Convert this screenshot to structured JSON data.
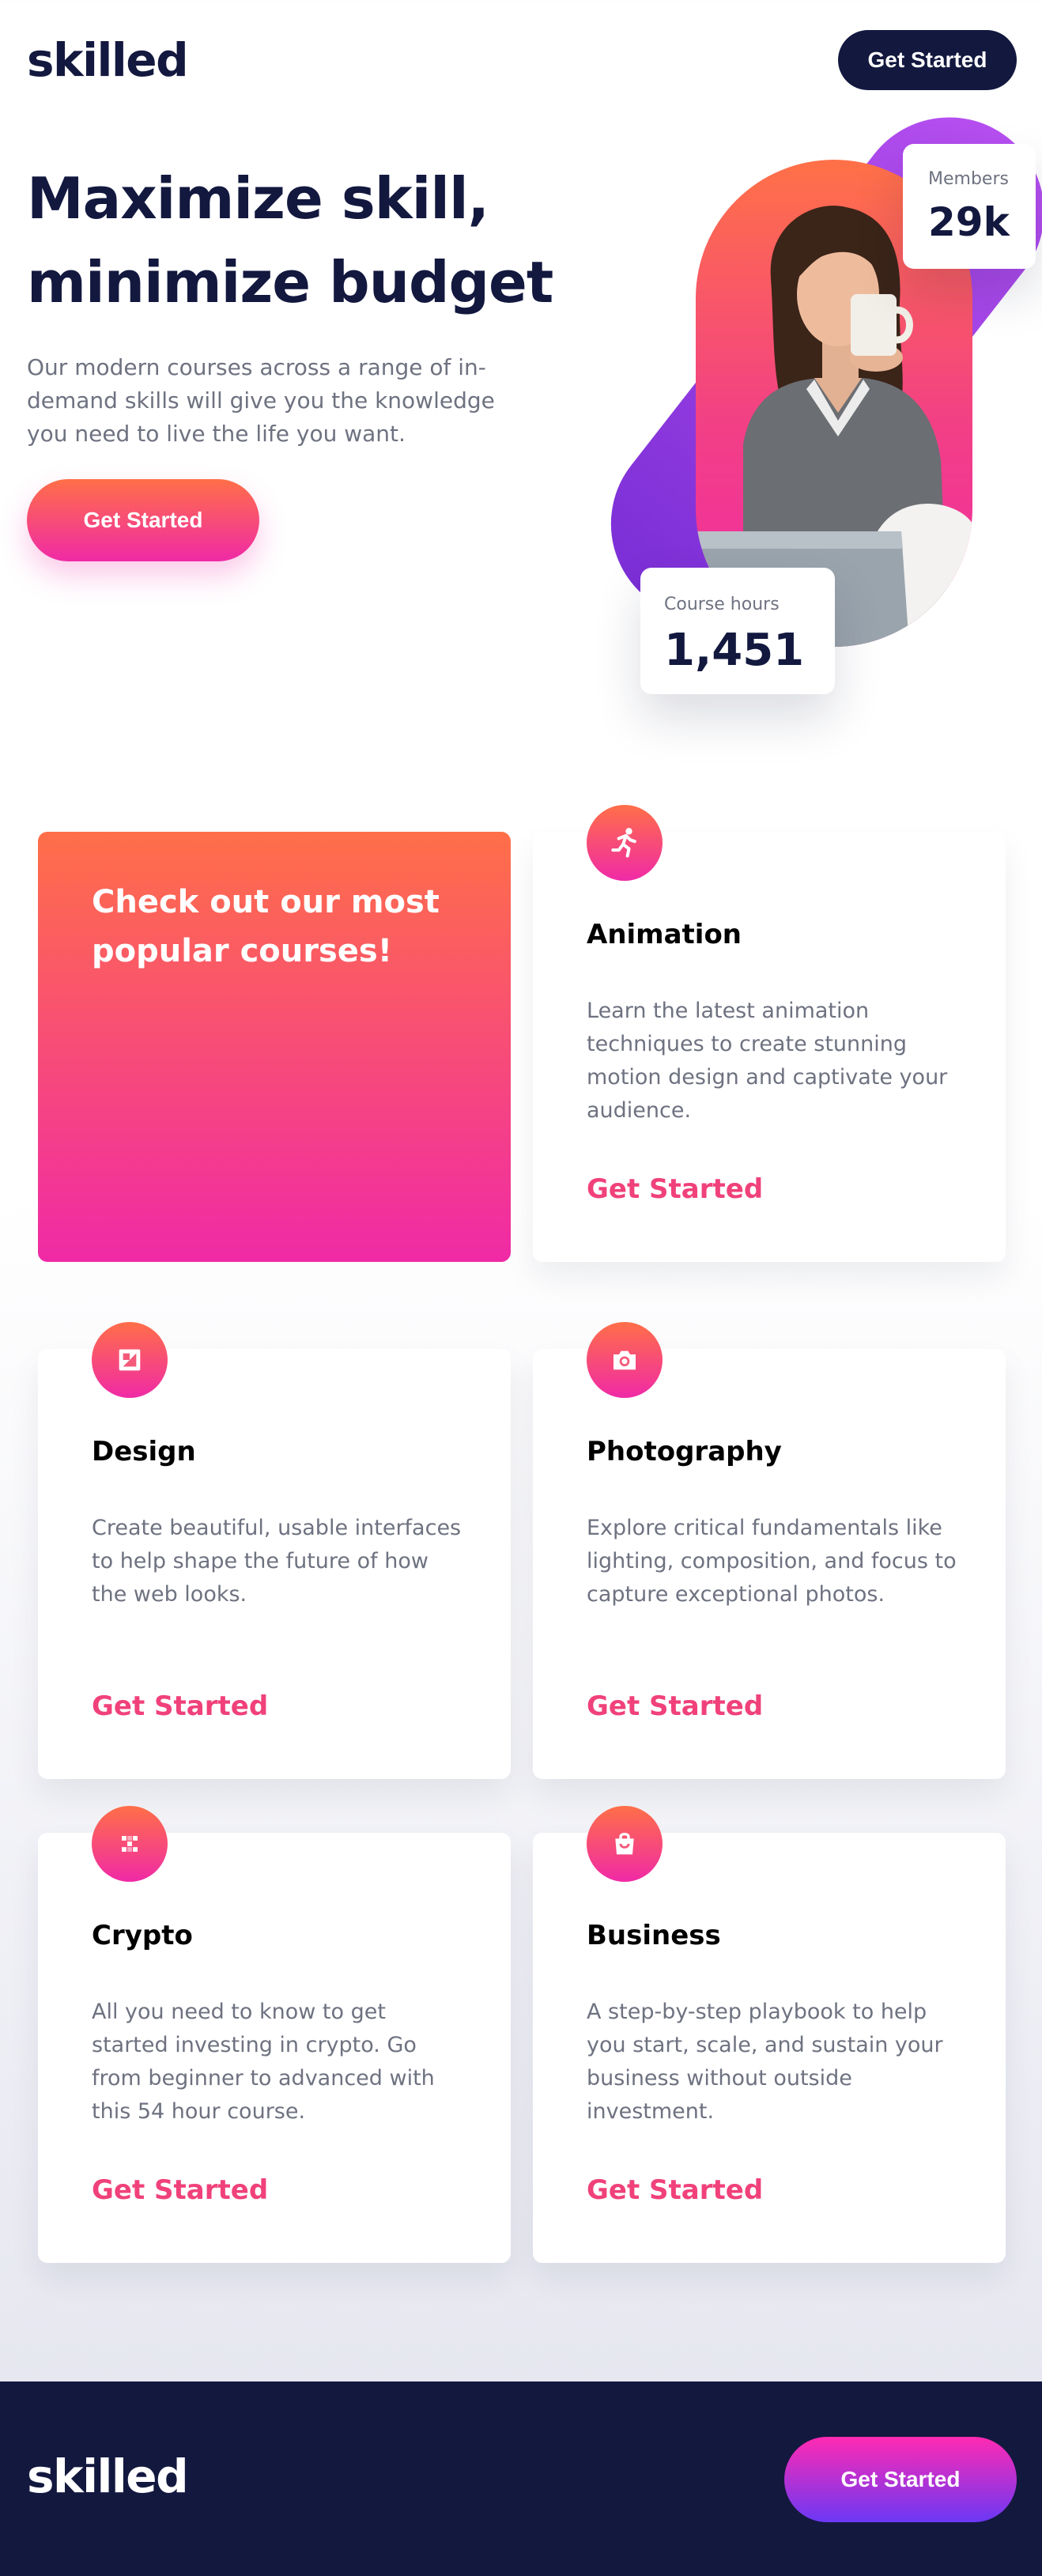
{
  "header": {
    "logo": "skilled",
    "cta_label": "Get Started"
  },
  "hero": {
    "title": "Maximize skill, minimize budget",
    "subtitle": "Our modern courses across a range of in-demand skills will give you the knowledge you need to live the life you want.",
    "cta_label": "Get Started",
    "stats": {
      "members_label": "Members",
      "members_value": "29k",
      "hours_label": "Course hours",
      "hours_value": "1,451"
    }
  },
  "courses": {
    "promo_title": "Check out our most popular courses!",
    "items": [
      {
        "icon": "running-person-icon",
        "title": "Animation",
        "description": "Learn the latest animation techniques to create stunning motion design and captivate your audience.",
        "link": "Get Started"
      },
      {
        "icon": "design-icon",
        "title": "Design",
        "description": "Create beautiful, usable interfaces to help shape the future of how the web looks.",
        "link": "Get Started"
      },
      {
        "icon": "camera-icon",
        "title": "Photography",
        "description": "Explore critical fundamentals like lighting, composition, and focus to capture exceptional photos.",
        "link": "Get Started"
      },
      {
        "icon": "crypto-icon",
        "title": "Crypto",
        "description": "All you need to know to get started investing in crypto. Go from beginner to advanced with this 54 hour course.",
        "link": "Get Started"
      },
      {
        "icon": "shopping-bag-icon",
        "title": "Business",
        "description": "A step-by-step playbook to help you start, scale, and sustain your business without outside investment.",
        "link": "Get Started"
      }
    ]
  },
  "footer": {
    "logo": "skilled",
    "cta_label": "Get Started"
  },
  "colors": {
    "navy": "#13183f",
    "gradient_start": "#ff6f48",
    "gradient_end": "#f02aa6",
    "link_pink": "#f0417a",
    "footer_button_end": "#6b38f5",
    "purple_accent": "#b64ff0"
  }
}
